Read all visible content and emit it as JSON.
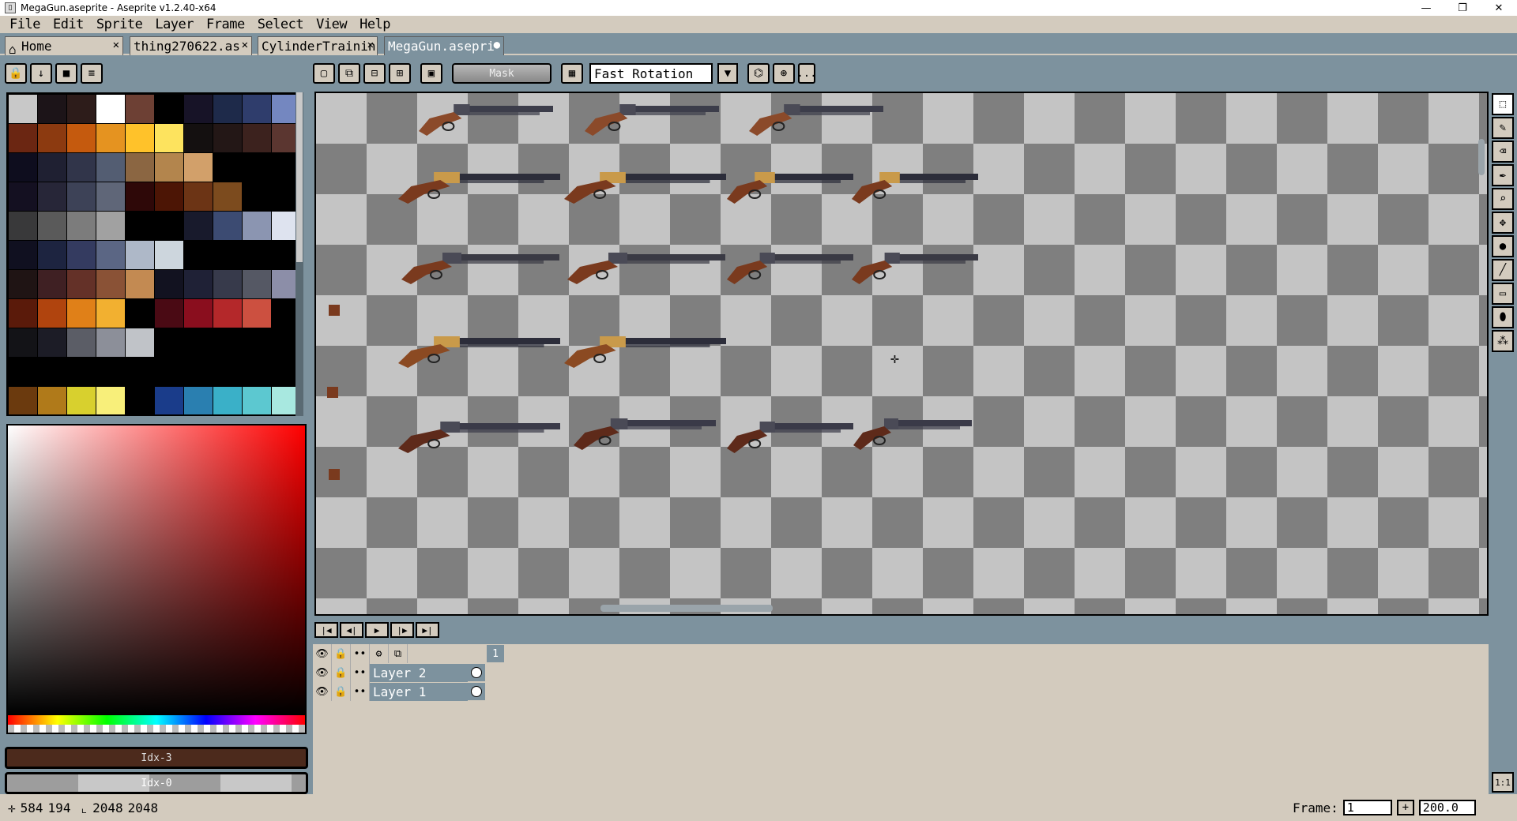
{
  "window": {
    "title": "MegaGun.aseprite - Aseprite v1.2.40-x64",
    "minimize": "—",
    "restore": "❐",
    "close": "✕"
  },
  "menu": [
    "File",
    "Edit",
    "Sprite",
    "Layer",
    "Frame",
    "Select",
    "View",
    "Help"
  ],
  "tabs": [
    {
      "label": "Home",
      "close": "✕",
      "active": false
    },
    {
      "label": "thing270622.as",
      "close": "✕",
      "active": false
    },
    {
      "label": "CylinderTrainin",
      "close": "✕",
      "active": false
    },
    {
      "label": "MegaGun.asepri",
      "close": "●",
      "active": true
    }
  ],
  "palette": {
    "colors": [
      "#c8c8c8",
      "#1c1418",
      "#2d1c1a",
      "#ffffff",
      "#6d4034",
      "#000000",
      "#171327",
      "#1e2a4a",
      "#2f3d6c",
      "#7487c0",
      "#6b2612",
      "#8c3a10",
      "#c55a0e",
      "#e59320",
      "#ffc22a",
      "#fde35e",
      "#141010",
      "#231716",
      "#3c221e",
      "#5b3630",
      "#0e0d1e",
      "#1f2032",
      "#31354a",
      "#535d72",
      "#8b6642",
      "#b3854d",
      "#d2a06a",
      "#000000",
      "#000000",
      "#000000",
      "#141021",
      "#272638",
      "#3d4257",
      "#5f6678",
      "#2e0808",
      "#4c1505",
      "#6c3415",
      "#7c4b1e",
      "#000000",
      "#000000",
      "#39393a",
      "#5a5a5a",
      "#7c7c7c",
      "#a1a1a1",
      "#000000",
      "#000000",
      "#181a2c",
      "#3c4b72",
      "#8b95b1",
      "#dee3ef",
      "#101020",
      "#1d2440",
      "#343b60",
      "#5b6684",
      "#aeb8c8",
      "#cdd6dd",
      "#000000",
      "#000000",
      "#000000",
      "#000000",
      "#1f1414",
      "#3f2023",
      "#643128",
      "#8a5236",
      "#c38a52",
      "#121220",
      "#1f2136",
      "#373a4b",
      "#555864",
      "#8c8ea8",
      "#5a1a0a",
      "#b0440e",
      "#e08018",
      "#f2b030",
      "#000000",
      "#4a0a14",
      "#8a0e1e",
      "#b4282a",
      "#cc5040",
      "#000000",
      "#131317",
      "#1c1c26",
      "#5b5d66",
      "#8c8f99",
      "#c0c3c8",
      "#000000",
      "#000000",
      "#000000",
      "#000000",
      "#000000",
      "#000000",
      "#000000",
      "#000000",
      "#000000",
      "#000000",
      "#000000",
      "#000000",
      "#000000",
      "#000000",
      "#000000",
      "#6b3a0e",
      "#b07a1a",
      "#d8d02e",
      "#f8ef7a",
      "#000000",
      "#1a3c8a",
      "#2a7fb0",
      "#3ab0c8",
      "#5cc8d0",
      "#a8e8e0"
    ]
  },
  "colors": {
    "fg_label": "Idx-3",
    "bg_label": "Idx-0",
    "fg_hex": "#4c2a1c"
  },
  "context_bar": {
    "mask_label": "Mask",
    "rotation_algorithm": "Fast Rotation",
    "more": "..."
  },
  "timeline": {
    "frame_number": "1",
    "layers": [
      {
        "name": "Layer 2"
      },
      {
        "name": "Layer 1"
      }
    ]
  },
  "status": {
    "cursor_x": "584",
    "cursor_y": "194",
    "sprite_w": "2048",
    "sprite_h": "2048",
    "frame_label": "Frame:",
    "frame_value": "1",
    "zoom_value": "200.0",
    "zoom_reset": "1:1"
  }
}
